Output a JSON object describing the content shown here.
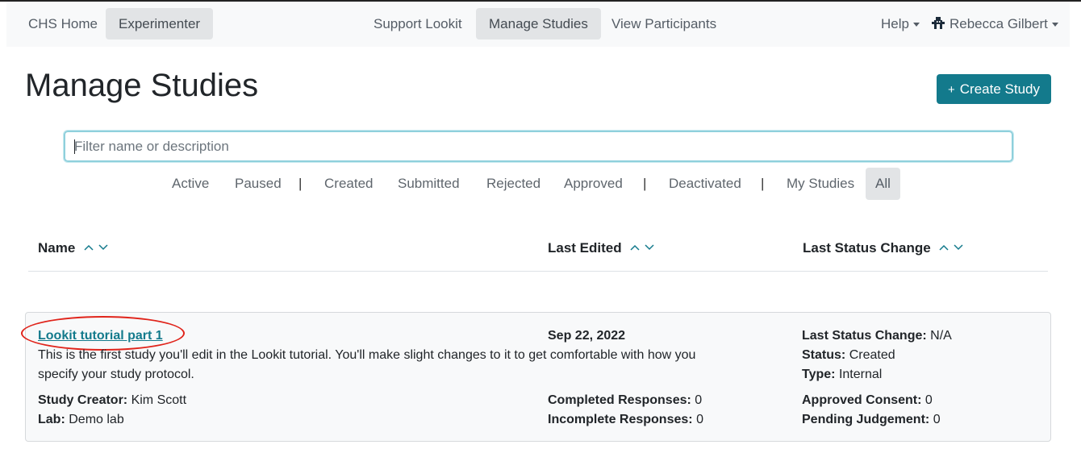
{
  "nav": {
    "home": "CHS Home",
    "experimenter": "Experimenter",
    "support": "Support Lookit",
    "manage": "Manage Studies",
    "participants": "View Participants",
    "help": "Help",
    "user": "Rebecca Gilbert"
  },
  "page": {
    "title": "Manage Studies",
    "create_button": "Create Study",
    "create_icon": "+"
  },
  "search": {
    "placeholder": "Filter name or description"
  },
  "filters": {
    "active": "Active",
    "paused": "Paused",
    "created": "Created",
    "submitted": "Submitted",
    "rejected": "Rejected",
    "approved": "Approved",
    "deactivated": "Deactivated",
    "my_studies": "My Studies",
    "all": "All",
    "separator": "|"
  },
  "columns": {
    "name": "Name",
    "last_edited": "Last Edited",
    "last_status_change": "Last Status Change"
  },
  "study": {
    "title": "Lookit tutorial part 1",
    "description_line1": "This is the first study you'll edit in the Lookit tutorial. You'll make slight changes to it to get comfortable with how you",
    "description_line2": "specify your study protocol.",
    "creator_label": "Study Creator:",
    "creator": "Kim Scott",
    "lab_label": "Lab:",
    "lab": "Demo lab",
    "last_edited": "Sep 22, 2022",
    "completed_label": "Completed Responses:",
    "completed": "0",
    "incomplete_label": "Incomplete Responses:",
    "incomplete": "0",
    "status_change_label": "Last Status Change:",
    "status_change": "N/A",
    "status_label": "Status:",
    "status": "Created",
    "type_label": "Type:",
    "type": "Internal",
    "approved_consent_label": "Approved Consent:",
    "approved_consent": "0",
    "pending_label": "Pending Judgement:",
    "pending": "0"
  },
  "colors": {
    "accent": "#137a8c",
    "highlight": "#e0241b"
  },
  "icons": {
    "user": "user-icon",
    "sort": "sort-chevrons-icon"
  }
}
